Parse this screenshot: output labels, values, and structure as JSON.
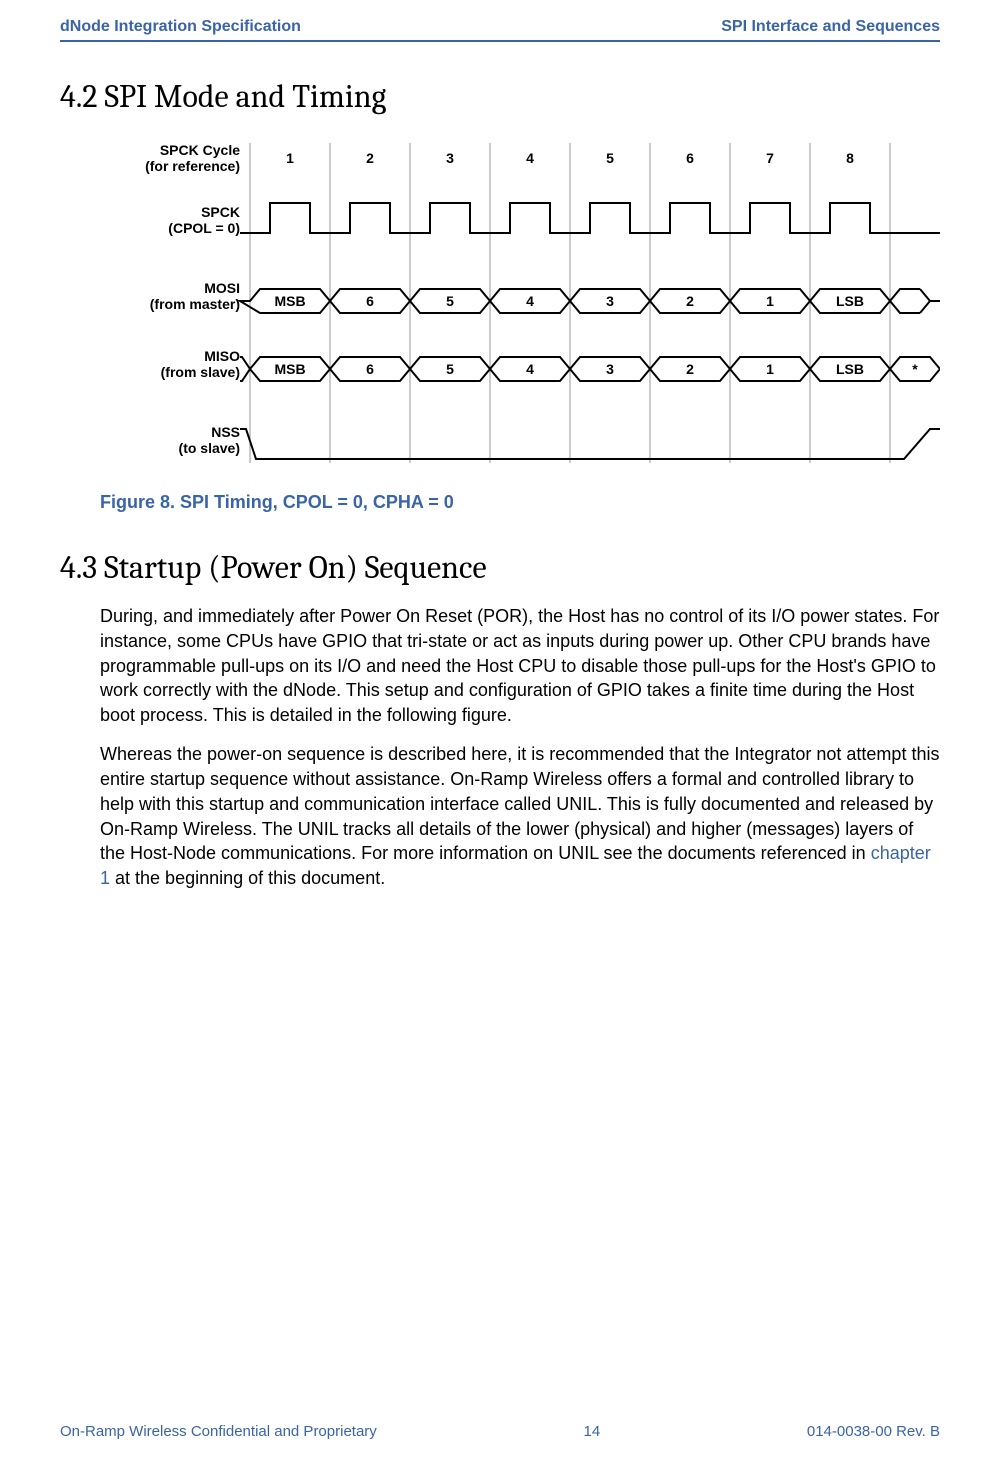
{
  "header": {
    "left": "dNode Integration Specification",
    "right": "SPI Interface and Sequences"
  },
  "section42": {
    "title": "4.2 SPI Mode and Timing"
  },
  "chart_data": {
    "type": "table",
    "title": "SPI Timing, CPOL = 0, CPHA = 0",
    "cycles": [
      "1",
      "2",
      "3",
      "4",
      "5",
      "6",
      "7",
      "8"
    ],
    "signals": [
      {
        "name": "SPCK Cycle",
        "note": "(for reference)",
        "values": [
          "1",
          "2",
          "3",
          "4",
          "5",
          "6",
          "7",
          "8"
        ]
      },
      {
        "name": "SPCK",
        "note": "(CPOL = 0)",
        "values": [
          "clock",
          "clock",
          "clock",
          "clock",
          "clock",
          "clock",
          "clock",
          "clock"
        ]
      },
      {
        "name": "MOSI",
        "note": "(from master)",
        "values": [
          "MSB",
          "6",
          "5",
          "4",
          "3",
          "2",
          "1",
          "LSB"
        ]
      },
      {
        "name": "MISO",
        "note": "(from slave)",
        "values": [
          "MSB",
          "6",
          "5",
          "4",
          "3",
          "2",
          "1",
          "LSB",
          "*"
        ]
      },
      {
        "name": "NSS",
        "note": "(to slave)",
        "values": [
          "low",
          "low",
          "low",
          "low",
          "low",
          "low",
          "low",
          "low"
        ]
      }
    ]
  },
  "figure8": {
    "caption": "Figure 8. SPI Timing, CPOL = 0, CPHA = 0"
  },
  "section43": {
    "title": "4.3 Startup (Power On) Sequence",
    "p1": "During, and immediately after Power On Reset (POR), the Host has no control of its I/O power states. For instance, some CPUs have GPIO that tri-state or act as inputs during power up. Other CPU brands have programmable pull-ups on its I/O and need the Host CPU to disable those pull-ups for the Host's GPIO to work correctly with the dNode. This setup and configuration of GPIO takes a finite time during the Host boot process. This is detailed in the following figure.",
    "p2a": "Whereas the power-on sequence is described here, it is recommended that the Integrator not attempt this entire startup sequence without assistance. On-Ramp Wireless offers a formal and controlled library to help with this startup and communication interface called UNIL. This is fully documented and released by On-Ramp Wireless. The UNIL tracks all details of the lower (physical) and higher (messages) layers of the Host-Node communications. For more information on UNIL see the documents referenced in ",
    "p2link": "chapter 1",
    "p2b": " at the beginning of this document."
  },
  "footer": {
    "left": "On-Ramp Wireless Confidential and Proprietary",
    "center": "14",
    "right": "014-0038-00 Rev. B"
  }
}
